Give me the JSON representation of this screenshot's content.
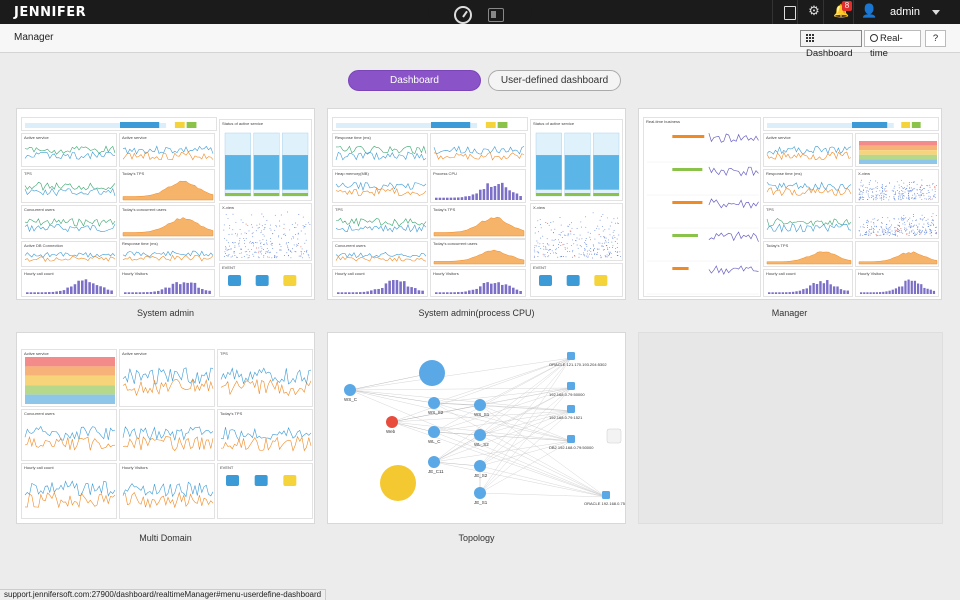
{
  "app": {
    "logo": "JENNIFER",
    "notification_count": "8",
    "user": "admin",
    "page_title": "Manager",
    "icons": [
      "dashboard-gauge-icon",
      "window-icon",
      "book-icon",
      "gear-icon",
      "bell-icon",
      "user-icon",
      "caret-down-icon",
      "grid-icon",
      "clock-icon",
      "help-icon"
    ]
  },
  "toolbar": {
    "dashboard_label": "Dashboard",
    "realtime_label": "Real-time",
    "help_label": "?"
  },
  "toggle": {
    "active": "Dashboard",
    "inactive": "User-defined dashboard"
  },
  "dashboards": [
    {
      "label": "System admin"
    },
    {
      "label": "System admin(process CPU)"
    },
    {
      "label": "Manager"
    },
    {
      "label": "Multi Domain"
    },
    {
      "label": "Topology"
    }
  ],
  "thumb_text": {
    "sa": [
      "Active service",
      "Status of active service",
      "TPS",
      "Today's TPS",
      "Concurrent users",
      "Today's concurrent users",
      "X-view",
      "Active DB Connection",
      "Response time (ms)",
      "Hourly call count",
      "Hourly Visitors",
      "EVENT"
    ],
    "sacpu": [
      "Response time (ms)",
      "Status of active service",
      "Heap memory(MB)",
      "Process CPU",
      "TPS",
      "Today's TPS",
      "X-view",
      "Concurrent users",
      "Today's concurrent users",
      "Hourly call count",
      "Hourly Visitors",
      "EVENT"
    ],
    "mgr": [
      "Real-time business",
      "Active service",
      "Response time (ms)",
      "X-view",
      "TPS",
      "Today's TPS",
      "Hourly call count",
      "Hourly Visitors"
    ],
    "md": [
      "Active service",
      "TPS",
      "Concurrent users",
      "Today's TPS",
      "Hourly call count",
      "Hourly Visitors",
      "EVENT"
    ],
    "topo_nodes": [
      "WS_C",
      "WS_S2",
      "WS_S1",
      "Web",
      "WL_C",
      "WL_S2",
      "JE_C11",
      "JE_S2",
      "JE_S1"
    ],
    "topo_dbs": [
      "ORACLE 121.170.193.204:5302",
      "192.168.0.79:50000",
      "192.168.0.79:1521",
      "DB2 192.168.0.79:50000",
      "ORACLE 192.168.0.75:1521"
    ]
  },
  "status_bar": {
    "url": "support.jennifersoft.com:27900/dashboard/realtimeManager#menu-userdefine-dashboard"
  },
  "colors": {
    "accent": "#8a53c8",
    "topbar": "#1b1b1b",
    "badge": "#e02d2d",
    "chart_blue": "#3c9bd6",
    "chart_orange": "#f08a24",
    "chart_purple": "#7b6fc8"
  }
}
